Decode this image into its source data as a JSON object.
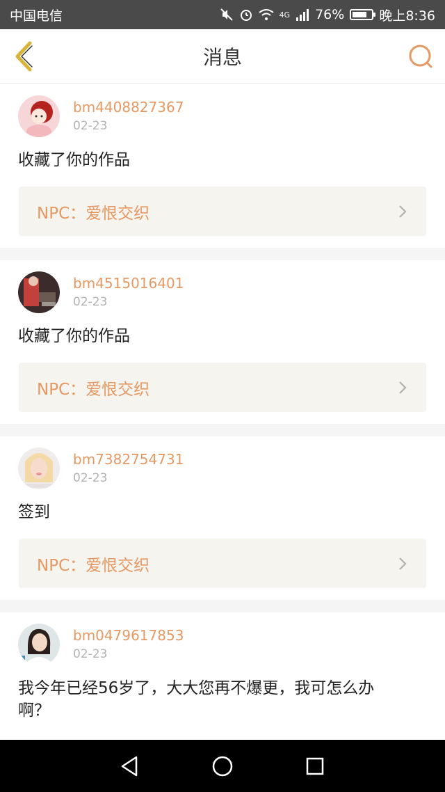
{
  "status_bar": {
    "carrier": "中国电信",
    "network": "4G",
    "battery_percent": "76%",
    "battery_level": 0.76,
    "time": "晚上8:36",
    "icons": [
      "mute-icon",
      "alarm-icon",
      "wifi-icon",
      "signal-icon",
      "battery-icon"
    ]
  },
  "header": {
    "title": "消息",
    "back_icon": "back-chevron-icon",
    "search_icon": "search-icon",
    "accent_color": "#e69863",
    "back_color": "#d9b43a"
  },
  "messages": [
    {
      "username": "bm4408827367",
      "date": "02-23",
      "text": "收藏了你的作品",
      "work": "NPC：爱恨交织"
    },
    {
      "username": "bm4515016401",
      "date": "02-23",
      "text": "收藏了你的作品",
      "work": "NPC：爱恨交织"
    },
    {
      "username": "bm7382754731",
      "date": "02-23",
      "text": "签到",
      "work": "NPC：爱恨交织"
    },
    {
      "username": "bm0479617853",
      "date": "02-23",
      "text": "我今年已经56岁了，大大您再不爆更，我可怎么办啊？"
    }
  ],
  "nav_bar": {
    "icons": [
      "back-triangle-icon",
      "home-circle-icon",
      "recents-square-icon"
    ]
  }
}
